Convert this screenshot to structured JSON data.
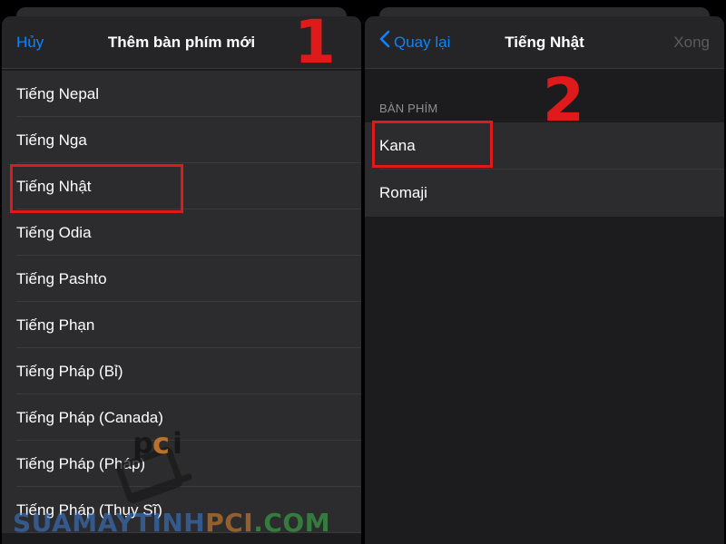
{
  "left_panel": {
    "nav": {
      "cancel_label": "Hủy",
      "title": "Thêm bàn phím mới"
    },
    "languages": [
      "Tiếng Nepal",
      "Tiếng Nga",
      "Tiếng Nhật",
      "Tiếng Odia",
      "Tiếng Pashto",
      "Tiếng Phạn",
      "Tiếng Pháp (Bỉ)",
      "Tiếng Pháp (Canada)",
      "Tiếng Pháp (Pháp)",
      "Tiếng Pháp (Thụy Sĩ)"
    ]
  },
  "right_panel": {
    "nav": {
      "back_label": "Quay lại",
      "title": "Tiếng Nhật",
      "done_label": "Xong"
    },
    "section_header": "BÀN PHÍM",
    "keyboards": [
      "Kana",
      "Romaji"
    ]
  },
  "annotations": {
    "step1": "1",
    "step2": "2"
  },
  "watermark": {
    "logo_text": "pci",
    "site_part1": "SUAMAYTINH",
    "site_part2": "PCI",
    "site_part3": ".COM"
  },
  "colors": {
    "accent": "#0a84ff",
    "highlight": "#e0191b",
    "disabled": "#5b5b60",
    "row_bg": "#2c2c2e",
    "watermark_blue": "#3d7fd6",
    "watermark_orange": "#e8892b",
    "watermark_green": "#3dbd4a"
  },
  "icons": {
    "back": "chevron-left-icon"
  }
}
